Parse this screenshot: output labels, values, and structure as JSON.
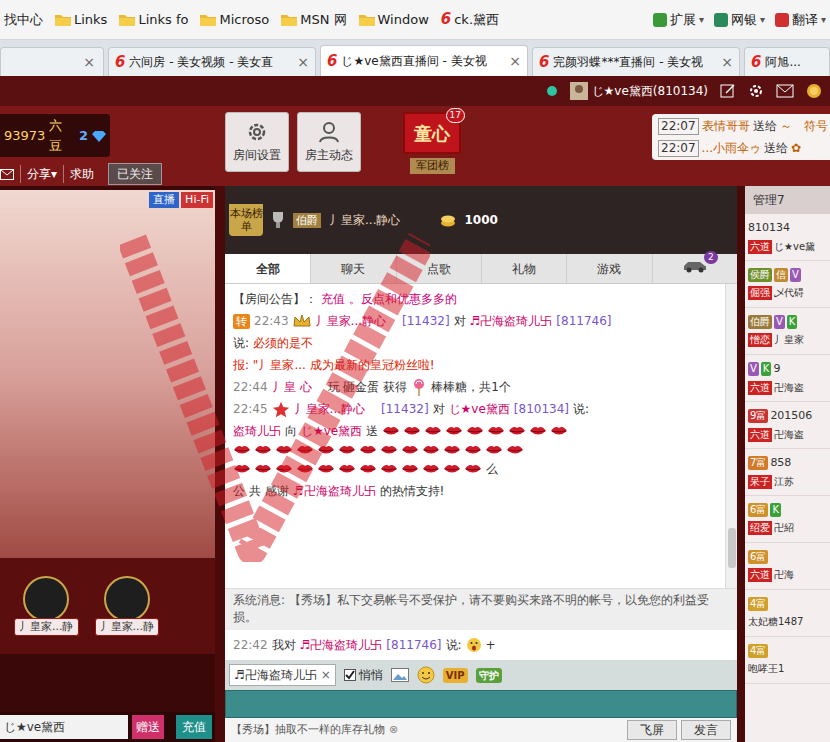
{
  "bookmarks_bar": {
    "logo": "6",
    "items": [
      {
        "label": "找中心",
        "kind": "plain"
      },
      {
        "label": "Links",
        "kind": "folder"
      },
      {
        "label": "Links fo",
        "kind": "folder"
      },
      {
        "label": "Microso",
        "kind": "folder"
      },
      {
        "label": "MSN 网",
        "kind": "folder"
      },
      {
        "label": "Window",
        "kind": "folder"
      },
      {
        "label": "ck.黛西",
        "kind": "site"
      }
    ],
    "tools": [
      {
        "label": "扩展",
        "arrow": "▾",
        "color": "#3a9a3a"
      },
      {
        "label": "网银",
        "arrow": "▾",
        "color": "#2a8a5a"
      },
      {
        "label": "翻译",
        "arrow": "▾",
        "color": "#d03030"
      }
    ]
  },
  "tabs": {
    "partial_close": "×",
    "items": [
      {
        "label": "六间房 - 美女视频 - 美女直",
        "close": "×",
        "selected": false
      },
      {
        "label": "じ★ve黛西直播间 - 美女视",
        "close": "×",
        "selected": true
      },
      {
        "label": "完颜羽蝶***直播间 - 美女视",
        "close": "×",
        "selected": false
      },
      {
        "label": "阿旭...",
        "selected": false
      }
    ]
  },
  "header": {
    "user": "じ★ve黛西(810134)"
  },
  "account": {
    "coins": "93973",
    "currency": "六豆",
    "level": "2",
    "links": [
      "分享▾",
      "求助"
    ],
    "follow": "已关注"
  },
  "room_buttons": [
    {
      "label": "房间设置",
      "kind": "settings"
    },
    {
      "label": "房主动态",
      "kind": "profile"
    }
  ],
  "legion": {
    "name": "童心",
    "badge": "17",
    "label": "军团榜"
  },
  "gift_feed": [
    {
      "time": "22:07",
      "from": "表情哥哥",
      "verb": "送给",
      "to": "～ゝ符号"
    },
    {
      "time": "22:07",
      "from": "...小雨伞ゥ",
      "verb": "送给",
      "to": "✿"
    }
  ],
  "video": {
    "badges": [
      {
        "text": "直播",
        "color": "#2f64c8"
      },
      {
        "text": "Hi-Fi",
        "color": "#cc3333"
      }
    ],
    "fans": [
      "丿皇家...静",
      "丿皇家...静"
    ],
    "anchor": "じ★ve黛西",
    "gift_button": "赠送",
    "recharge_button": "充值"
  },
  "chat": {
    "rank": {
      "label": "本场榜单",
      "title": "伯爵",
      "user": "丿皇家...静心ゝ",
      "score": "1000"
    },
    "tabs": [
      {
        "kind": "text",
        "label": "全部",
        "selected": true
      },
      {
        "kind": "text",
        "label": "聊天",
        "selected": false
      },
      {
        "kind": "text",
        "label": "点歌",
        "selected": false
      },
      {
        "kind": "text",
        "label": "礼物",
        "selected": false
      },
      {
        "kind": "text",
        "label": "游戏",
        "selected": false
      },
      {
        "kind": "car",
        "badge": "2",
        "selected": false
      }
    ],
    "messages": [
      {
        "segments": [
          {
            "kind": "text",
            "text": "【房间公告】：",
            "color": "#333333"
          },
          {
            "kind": "text",
            "text": "充值",
            "color": "#cc0077"
          },
          {
            "kind": "text",
            "text": "。反点和优惠多多的",
            "color": "#cc0077"
          }
        ]
      },
      {
        "segments": [
          {
            "kind": "tag",
            "text": "转",
            "color": "#e8861a"
          },
          {
            "kind": "text",
            "text": "22:43",
            "color": "#888888"
          },
          {
            "kind": "crown"
          },
          {
            "kind": "text",
            "text": "丿皇家...静心ゝ",
            "color": "#cc0066"
          },
          {
            "kind": "text",
            "text": "[11432]",
            "color": "#7755cc"
          },
          {
            "kind": "text",
            "text": "对",
            "color": "#333333"
          },
          {
            "kind": "text",
            "text": "♬卍海盗琦儿卐",
            "color": "#cc0066"
          },
          {
            "kind": "text",
            "text": "[811746]",
            "color": "#7755cc"
          }
        ]
      },
      {
        "segments": [
          {
            "kind": "text",
            "text": "说:",
            "color": "#333333"
          },
          {
            "kind": "text",
            "text": "必须的是不",
            "color": "#dd2200"
          }
        ]
      },
      {
        "segments": [
          {
            "kind": "text",
            "text": "报: \"丿皇家...",
            "color": "#dd2200"
          },
          {
            "kind": "text",
            "text": "成为最新的皇冠粉丝啦!",
            "color": "#dd2200"
          }
        ]
      },
      {
        "segments": [
          {
            "kind": "text",
            "text": "22:44",
            "color": "#888888"
          },
          {
            "kind": "text",
            "text": "丿皇",
            "color": "#cc0066"
          },
          {
            "kind": "text",
            "text": "心ゝ",
            "color": "#cc0066"
          },
          {
            "kind": "text",
            "text": "玩 砸金蛋 获得",
            "color": "#333333"
          },
          {
            "kind": "candy"
          },
          {
            "kind": "text",
            "text": "棒棒糖，共1个",
            "color": "#333333"
          }
        ]
      },
      {
        "segments": [
          {
            "kind": "text",
            "text": "22:45",
            "color": "#888888"
          },
          {
            "kind": "star"
          },
          {
            "kind": "text",
            "text": "丿皇家...静心ゝ",
            "color": "#cc0066"
          },
          {
            "kind": "text",
            "text": "[11432]",
            "color": "#7755cc"
          },
          {
            "kind": "text",
            "text": "对",
            "color": "#333333"
          },
          {
            "kind": "text",
            "text": "じ★ve黛西",
            "color": "#cc0066"
          },
          {
            "kind": "text",
            "text": "[810134]",
            "color": "#7755cc"
          },
          {
            "kind": "text",
            "text": "说:",
            "color": "#333333"
          }
        ]
      },
      {
        "segments": [
          {
            "kind": "text",
            "text": "盗琦儿卐",
            "color": "#cc0066"
          },
          {
            "kind": "text",
            "text": "向",
            "color": "#333333"
          },
          {
            "kind": "text",
            "text": "じ★ve黛西",
            "color": "#cc0066"
          },
          {
            "kind": "text",
            "text": "送",
            "color": "#333333"
          },
          {
            "kind": "lips",
            "count": 9
          }
        ]
      },
      {
        "segments": [
          {
            "kind": "lips",
            "count": 14
          }
        ]
      },
      {
        "segments": [
          {
            "kind": "lips",
            "count": 12
          },
          {
            "kind": "text",
            "text": "么",
            "color": "#333333"
          }
        ]
      },
      {
        "segments": [
          {
            "kind": "text",
            "text": "公 共",
            "color": "#333333"
          },
          {
            "kind": "text",
            "text": "感谢",
            "color": "#333333"
          },
          {
            "kind": "text",
            "text": "♬卍海盗琦儿卐",
            "color": "#cc0066"
          },
          {
            "kind": "text",
            "text": "的热情支持!",
            "color": "#333333"
          }
        ]
      }
    ],
    "system": {
      "label": "系统消息:",
      "text": "【秀场】私下交易帐号不受保护，请不要购买来路不明的帐号，以免您的利益受损。"
    },
    "own": {
      "segments": [
        {
          "kind": "text",
          "text": "22:42",
          "color": "#888888"
        },
        {
          "kind": "text",
          "text": "我对",
          "color": "#333333"
        },
        {
          "kind": "text",
          "text": "♬卍海盗琦儿卐",
          "color": "#cc0066"
        },
        {
          "kind": "text",
          "text": "[811746]",
          "color": "#7755cc"
        },
        {
          "kind": "text",
          "text": "说:",
          "color": "#333333"
        },
        {
          "kind": "face"
        },
        {
          "kind": "text",
          "text": "+",
          "color": "#333333"
        }
      ]
    }
  },
  "composer": {
    "target": "♬卍海盗琦儿卐",
    "target_close": "×",
    "whisper": {
      "label": "悄悄",
      "checked": true
    },
    "tools": [
      {
        "kind": "image"
      },
      {
        "kind": "emoji"
      },
      {
        "kind": "vip",
        "text": "VIP"
      },
      {
        "kind": "guard",
        "text": "守护"
      }
    ],
    "promo": "【秀场】抽取不一样的库存礼物",
    "promo_close": "⊗",
    "buttons": [
      "飞屏",
      "发言"
    ]
  },
  "users": {
    "header": "管理7",
    "items": [
      {
        "badges": [],
        "id": "810134",
        "tag": "六道",
        "name": "じ★ve黛"
      },
      {
        "badges": [
          {
            "text": "侯爵",
            "color": "#6f8f2a"
          },
          {
            "text": "信",
            "color": "#c08a30"
          },
          {
            "text": "V",
            "color": "#9b59b6"
          }
        ],
        "tag": "倔强",
        "name": "乄代碍"
      },
      {
        "badges": [
          {
            "text": "伯爵",
            "color": "#9a7a3a"
          },
          {
            "text": "V",
            "color": "#9b59b6"
          },
          {
            "text": "K",
            "color": "#3aa03a"
          }
        ],
        "tag": "憎恋",
        "name": "丿皇家"
      },
      {
        "badges": [
          {
            "text": "V",
            "color": "#9b59b6"
          },
          {
            "text": "K",
            "color": "#3aa03a"
          }
        ],
        "id": "9",
        "tag": "六道",
        "name": "卍海盗"
      },
      {
        "badges": [
          {
            "text": "9富",
            "color": "#cc3333"
          }
        ],
        "id": "201506",
        "tag": "六道",
        "name": "卍海盗"
      },
      {
        "badges": [
          {
            "text": "7富",
            "color": "#d07a2a"
          }
        ],
        "id": "858",
        "tag": "呆子",
        "name": "江苏"
      },
      {
        "badges": [
          {
            "text": "6富",
            "color": "#d0902a"
          },
          {
            "text": "K",
            "color": "#3aa03a"
          }
        ],
        "tag": "绍爱",
        "name": "卍紹"
      },
      {
        "badges": [
          {
            "text": "6富",
            "color": "#d0902a"
          }
        ],
        "tag": "六道",
        "name": "卍海"
      },
      {
        "badges": [
          {
            "text": "4富",
            "color": "#d0a02a"
          }
        ],
        "name": "太妃糖1487"
      },
      {
        "badges": [
          {
            "text": "4富",
            "color": "#d0a02a"
          }
        ],
        "name": "咆哮王1"
      }
    ]
  }
}
